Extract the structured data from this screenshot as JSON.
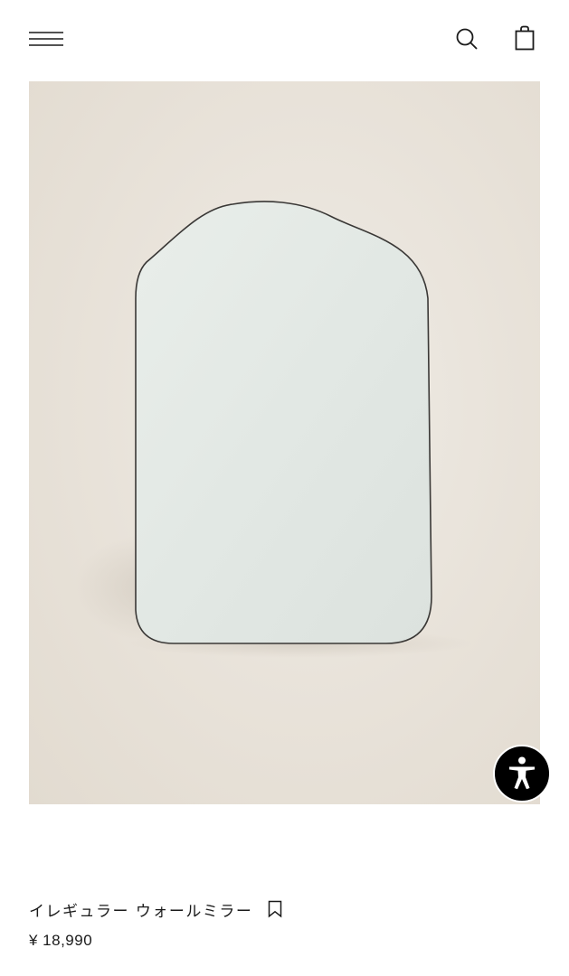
{
  "header": {
    "menu_icon": "hamburger-menu-icon",
    "search_icon": "search-icon",
    "bag_icon": "shopping-bag-icon"
  },
  "product": {
    "image_subject": "irregular-wall-mirror",
    "name": "イレギュラー ウォールミラー",
    "bookmark_icon": "bookmark-icon",
    "price": "¥ 18,990"
  },
  "accessibility": {
    "icon": "accessibility-person-icon",
    "color": "#000000"
  },
  "colors": {
    "background": "#ffffff",
    "image_backdrop": "#e8e2d9",
    "text": "#1a1a1a"
  }
}
